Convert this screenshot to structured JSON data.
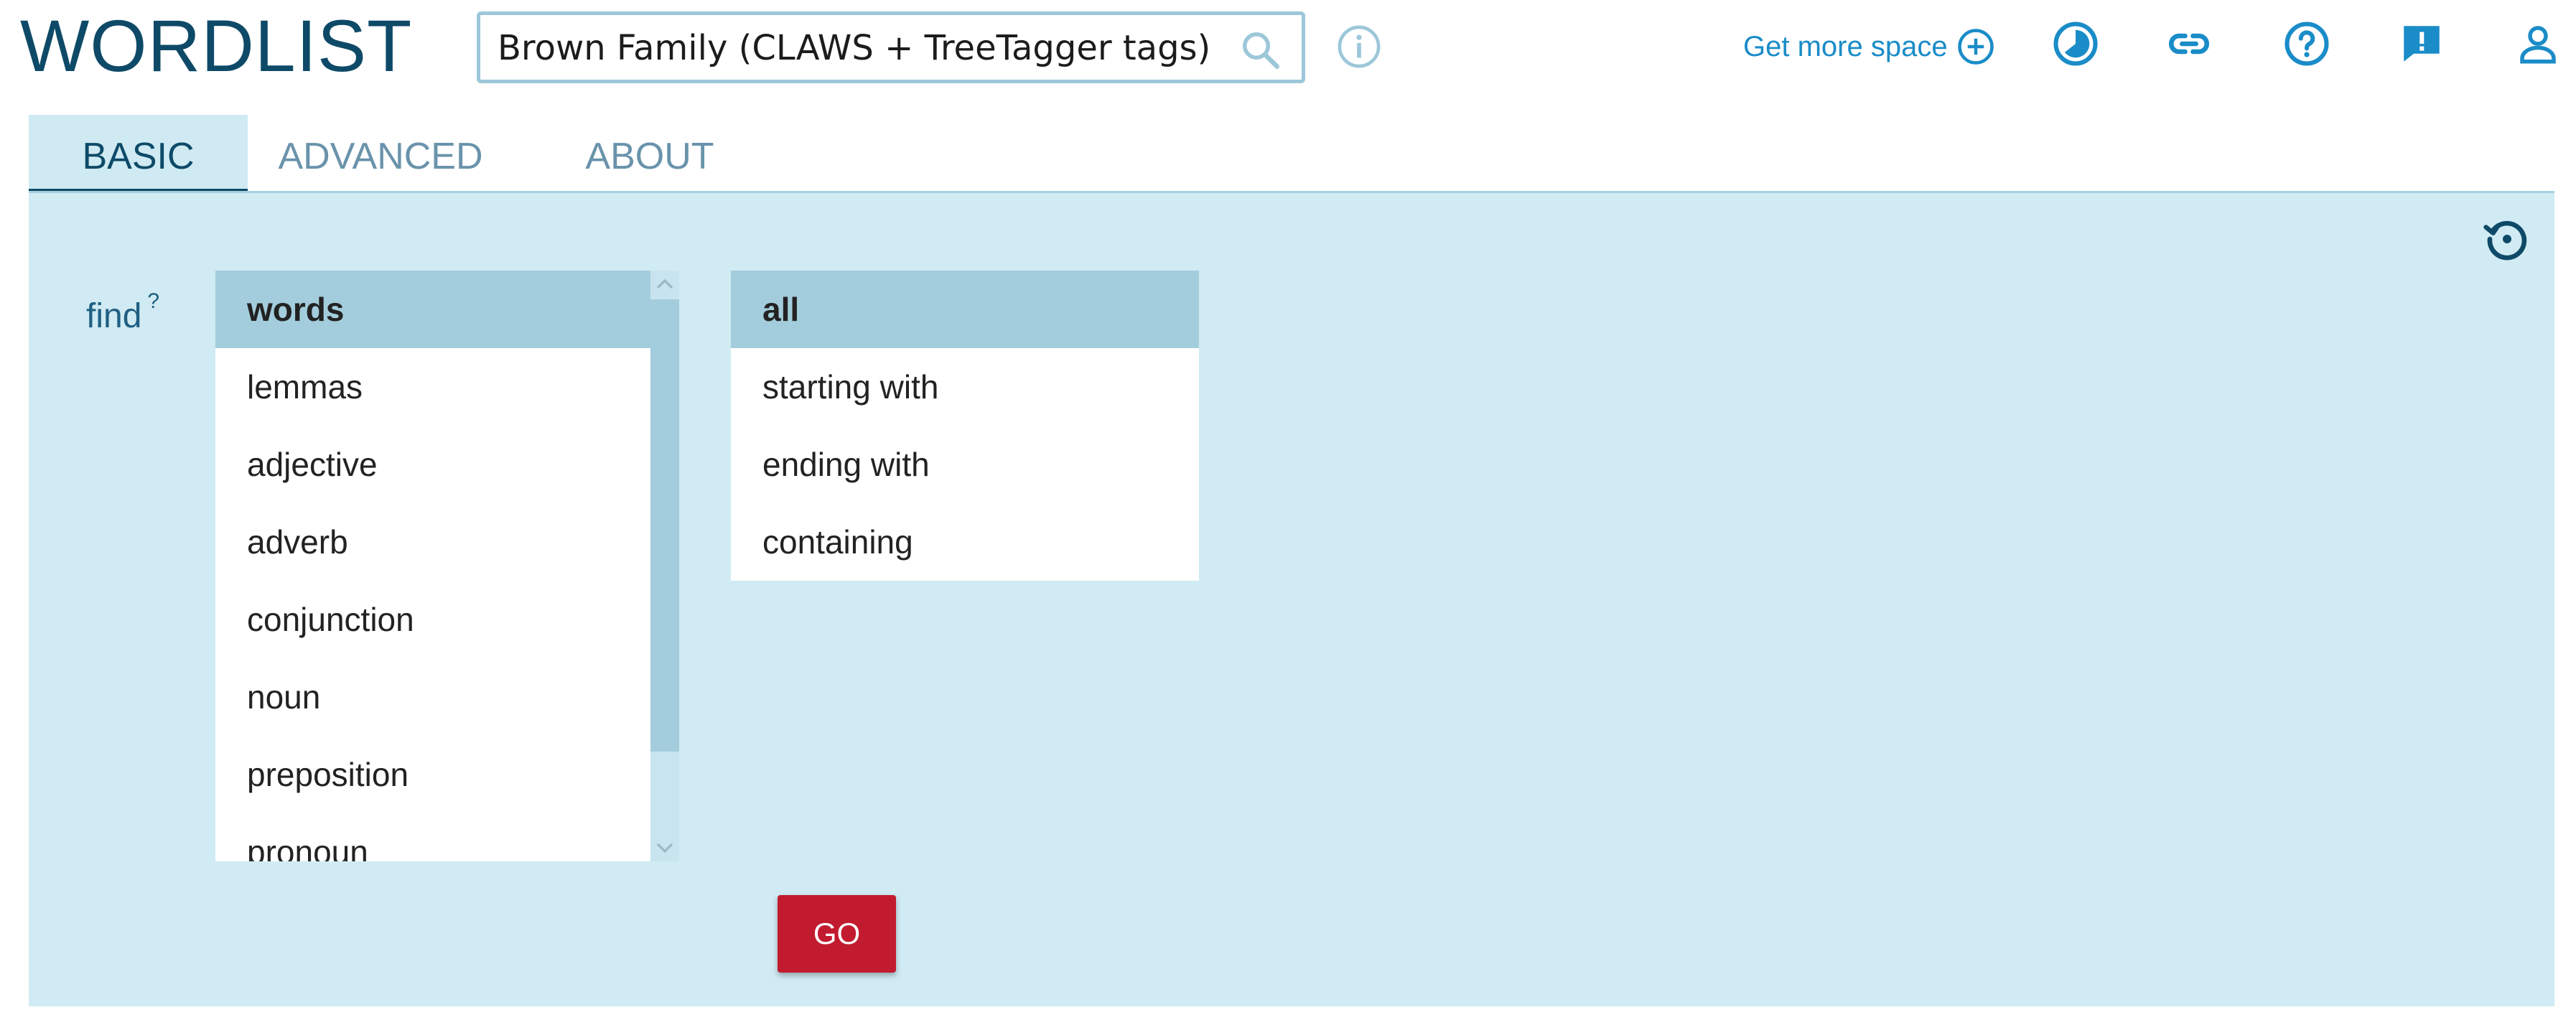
{
  "header": {
    "app_title": "WORDLIST",
    "corpus": "Brown Family (CLAWS + TreeTagger tags)",
    "corpus_icon": "search-icon",
    "info_icon": "info-icon",
    "get_more_space": "Get more space",
    "icons": [
      "plus-circle-icon",
      "pie-chart-icon",
      "link-icon",
      "help-icon",
      "feedback-icon",
      "user-icon"
    ]
  },
  "tabs": [
    {
      "label": "BASIC",
      "active": true
    },
    {
      "label": "ADVANCED",
      "active": false
    },
    {
      "label": "ABOUT",
      "active": false
    }
  ],
  "form": {
    "find_label": "find",
    "help_mark": "?",
    "find_options": [
      "words",
      "lemmas",
      "adjective",
      "adverb",
      "conjunction",
      "noun",
      "preposition",
      "pronoun"
    ],
    "find_selected": "words",
    "match_options": [
      "all",
      "starting with",
      "ending with",
      "containing"
    ],
    "match_selected": "all",
    "go_label": "GO"
  },
  "colors": {
    "brand": "#0e4a68",
    "accent": "#1a8cc8",
    "panel": "#d0ebf3",
    "selected": "#a3cddc",
    "go": "#c21b2f"
  }
}
